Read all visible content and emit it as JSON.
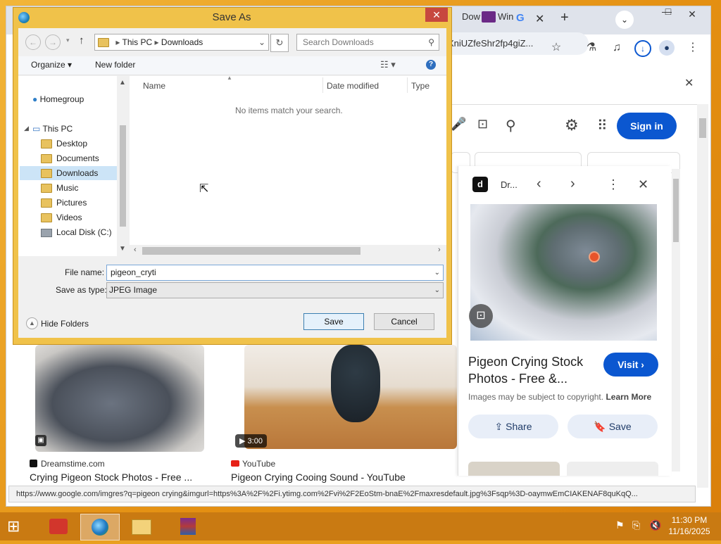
{
  "browser": {
    "tabs": [
      {
        "label": "Dow"
      },
      {
        "label": "Win"
      }
    ],
    "url_fragment": "XniUZfeShr2fp4giZ...",
    "signin_label": "Sign in",
    "results": [
      {
        "source": "Dreamstime.com",
        "title": "Crying Pigeon Stock Photos - Free ..."
      },
      {
        "source": "YouTube",
        "title": "Pigeon Crying Cooing Sound - YouTube",
        "duration": "3:00"
      }
    ],
    "panel": {
      "source_short": "Dr...",
      "title_line1": "Pigeon Crying Stock",
      "title_line2": "Photos - Free &...",
      "visit_label": "Visit",
      "copyright_text": "Images may be subject to copyright.",
      "learn_more_label": "Learn More",
      "share_label": "Share",
      "save_label": "Save"
    },
    "status_url": "https://www.google.com/imgres?q=pigeon crying&imgurl=https%3A%2F%2Fi.ytimg.com%2Fvi%2F2EoStm-bnaE%2Fmaxresdefault.jpg%3Fsqp%3D-oaymwEmCIAKENAF8quKqQ..."
  },
  "dialog": {
    "title": "Save As",
    "breadcrumb": [
      "This PC",
      "Downloads"
    ],
    "search_placeholder": "Search Downloads",
    "organize_label": "Organize",
    "new_folder_label": "New folder",
    "nav": {
      "homegroup": "Homegroup",
      "this_pc": "This PC",
      "items": [
        "Desktop",
        "Documents",
        "Downloads",
        "Music",
        "Pictures",
        "Videos",
        "Local Disk (C:)"
      ],
      "selected": "Downloads"
    },
    "columns": [
      "Name",
      "Date modified",
      "Type"
    ],
    "empty_message": "No items match your search.",
    "file_name_label": "File name:",
    "file_name_value": "pigeon_cryti",
    "save_type_label": "Save as type:",
    "save_type_value": "JPEG Image",
    "hide_folders_label": "Hide Folders",
    "save_button": "Save",
    "cancel_button": "Cancel"
  },
  "taskbar": {
    "time": "11:30 PM",
    "date": "11/16/2025"
  },
  "colors": {
    "accent_blue": "#0b57d0",
    "dialog_frame": "#f0c24a",
    "taskbar": "#c97a12"
  }
}
